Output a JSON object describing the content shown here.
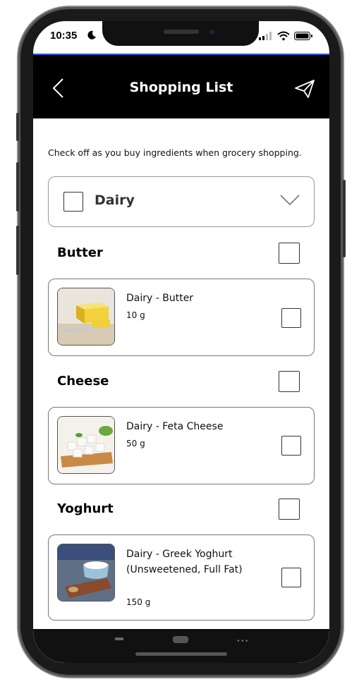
{
  "status": {
    "time": "10:35"
  },
  "header": {
    "title": "Shopping List"
  },
  "intro_text": "Check off as you buy ingredients when grocery shopping.",
  "category": {
    "label": "Dairy"
  },
  "groups": [
    {
      "title": "Butter",
      "item": {
        "name": "Dairy - Butter",
        "qty": "10 g"
      }
    },
    {
      "title": "Cheese",
      "item": {
        "name": "Dairy - Feta Cheese",
        "qty": "50 g"
      }
    },
    {
      "title": "Yoghurt",
      "item": {
        "name": "Dairy - Greek Yoghurt (Unsweetened, Full Fat)",
        "qty": "150 g"
      }
    }
  ],
  "colors": {
    "header_bg": "#000000",
    "accent_line": "#1e5bd6"
  },
  "icons": [
    "moon-icon",
    "signal-icon",
    "wifi-icon",
    "battery-icon",
    "back-arrow-icon",
    "send-icon",
    "chevron-down-icon"
  ]
}
